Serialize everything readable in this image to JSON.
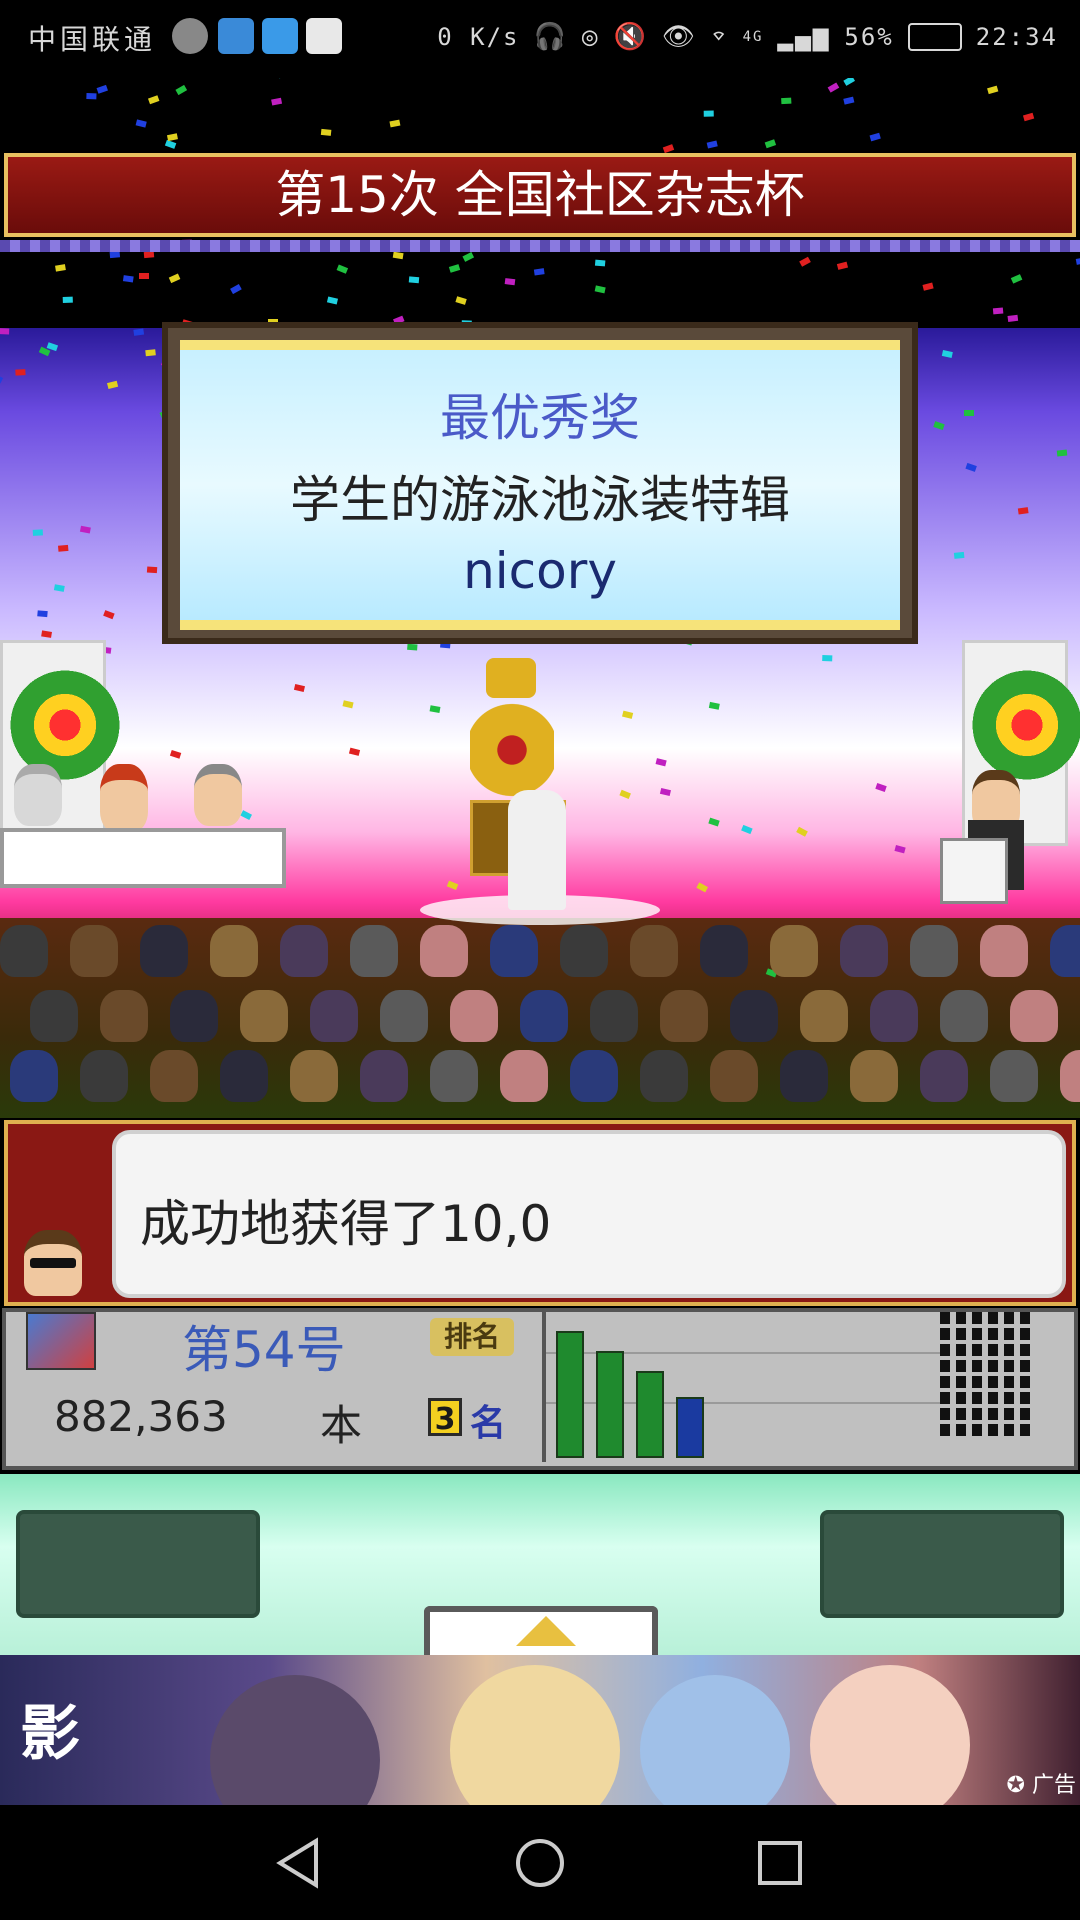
{
  "status_bar": {
    "carrier": "中国联通",
    "network_speed": "0 K/s",
    "signal_type": "4G",
    "battery": "56%",
    "time": "22:34",
    "icons": [
      "flame-app-icon",
      "whale-app-icon",
      "card-app-icon",
      "map-app-icon",
      "headset-icon",
      "hd-call-icon",
      "mute-icon",
      "eye-icon",
      "wifi-icon",
      "signal-icon",
      "battery-icon"
    ]
  },
  "game": {
    "banner_title": "第15次 全国社区杂志杯",
    "award": {
      "title": "最优秀奖",
      "work_name": "学生的游泳池泳装特辑",
      "author": "nicory"
    },
    "message": "成功地获得了10,0",
    "info_panel": {
      "issue": "第54号",
      "sales": "882,363",
      "sales_unit": "本",
      "rank_label": "排名",
      "rank": "3",
      "rank_unit": "名"
    },
    "chart_data": {
      "type": "bar",
      "categories": [
        "1",
        "2",
        "3",
        "4"
      ],
      "values": [
        100,
        84,
        68,
        48
      ],
      "colors": [
        "#1f8a2e",
        "#1f8a2e",
        "#1f8a2e",
        "#1a3aa0"
      ],
      "ylim": [
        0,
        110
      ]
    },
    "colors": {
      "banner": "#8a1814",
      "trim": "#e0b050",
      "panel": "#c0c0c0",
      "controls": "#8ae8c0"
    }
  },
  "ad": {
    "label": "广告"
  },
  "nav": {
    "icons": [
      "back-icon",
      "home-icon",
      "recents-icon"
    ]
  }
}
